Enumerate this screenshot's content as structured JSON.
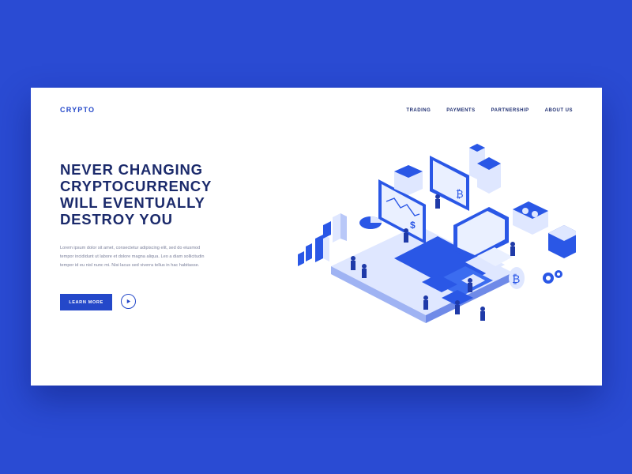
{
  "header": {
    "logo": "CRYPTO",
    "nav": [
      "TRADING",
      "PAYMENTS",
      "PARTNERSHIP",
      "ABOUT US"
    ]
  },
  "hero": {
    "title_lines": [
      "NEVER CHANGING",
      "CRYPTOCURRENCY",
      "WILL EVENTUALLY",
      "DESTROY YOU"
    ],
    "description_lines": [
      "Lorem ipsum dolor sit amet, consectetur adipiscing elit, sed do eiusmod",
      "tempor incididunt ut labore et dolore magna aliqua. Leo a diam sollicitudin",
      "tempor id eu nisl nunc mi. Nisi lacus sed viverra tellus in hac habitasse."
    ],
    "cta_label": "LEARN MORE"
  },
  "illustration": {
    "glyphs": {
      "bitcoin": "₿",
      "dollar": "$"
    }
  },
  "icons": {
    "play": "play-icon",
    "bitcoin": "bitcoin-icon",
    "dollar": "dollar-icon",
    "gear": "gear-icon"
  },
  "colors": {
    "background": "#2a4bd3",
    "card": "#ffffff",
    "accent": "#2448c9",
    "heading": "#1b2a6b",
    "body_text": "#7b809b",
    "light_blue": "#dfe7ff"
  }
}
